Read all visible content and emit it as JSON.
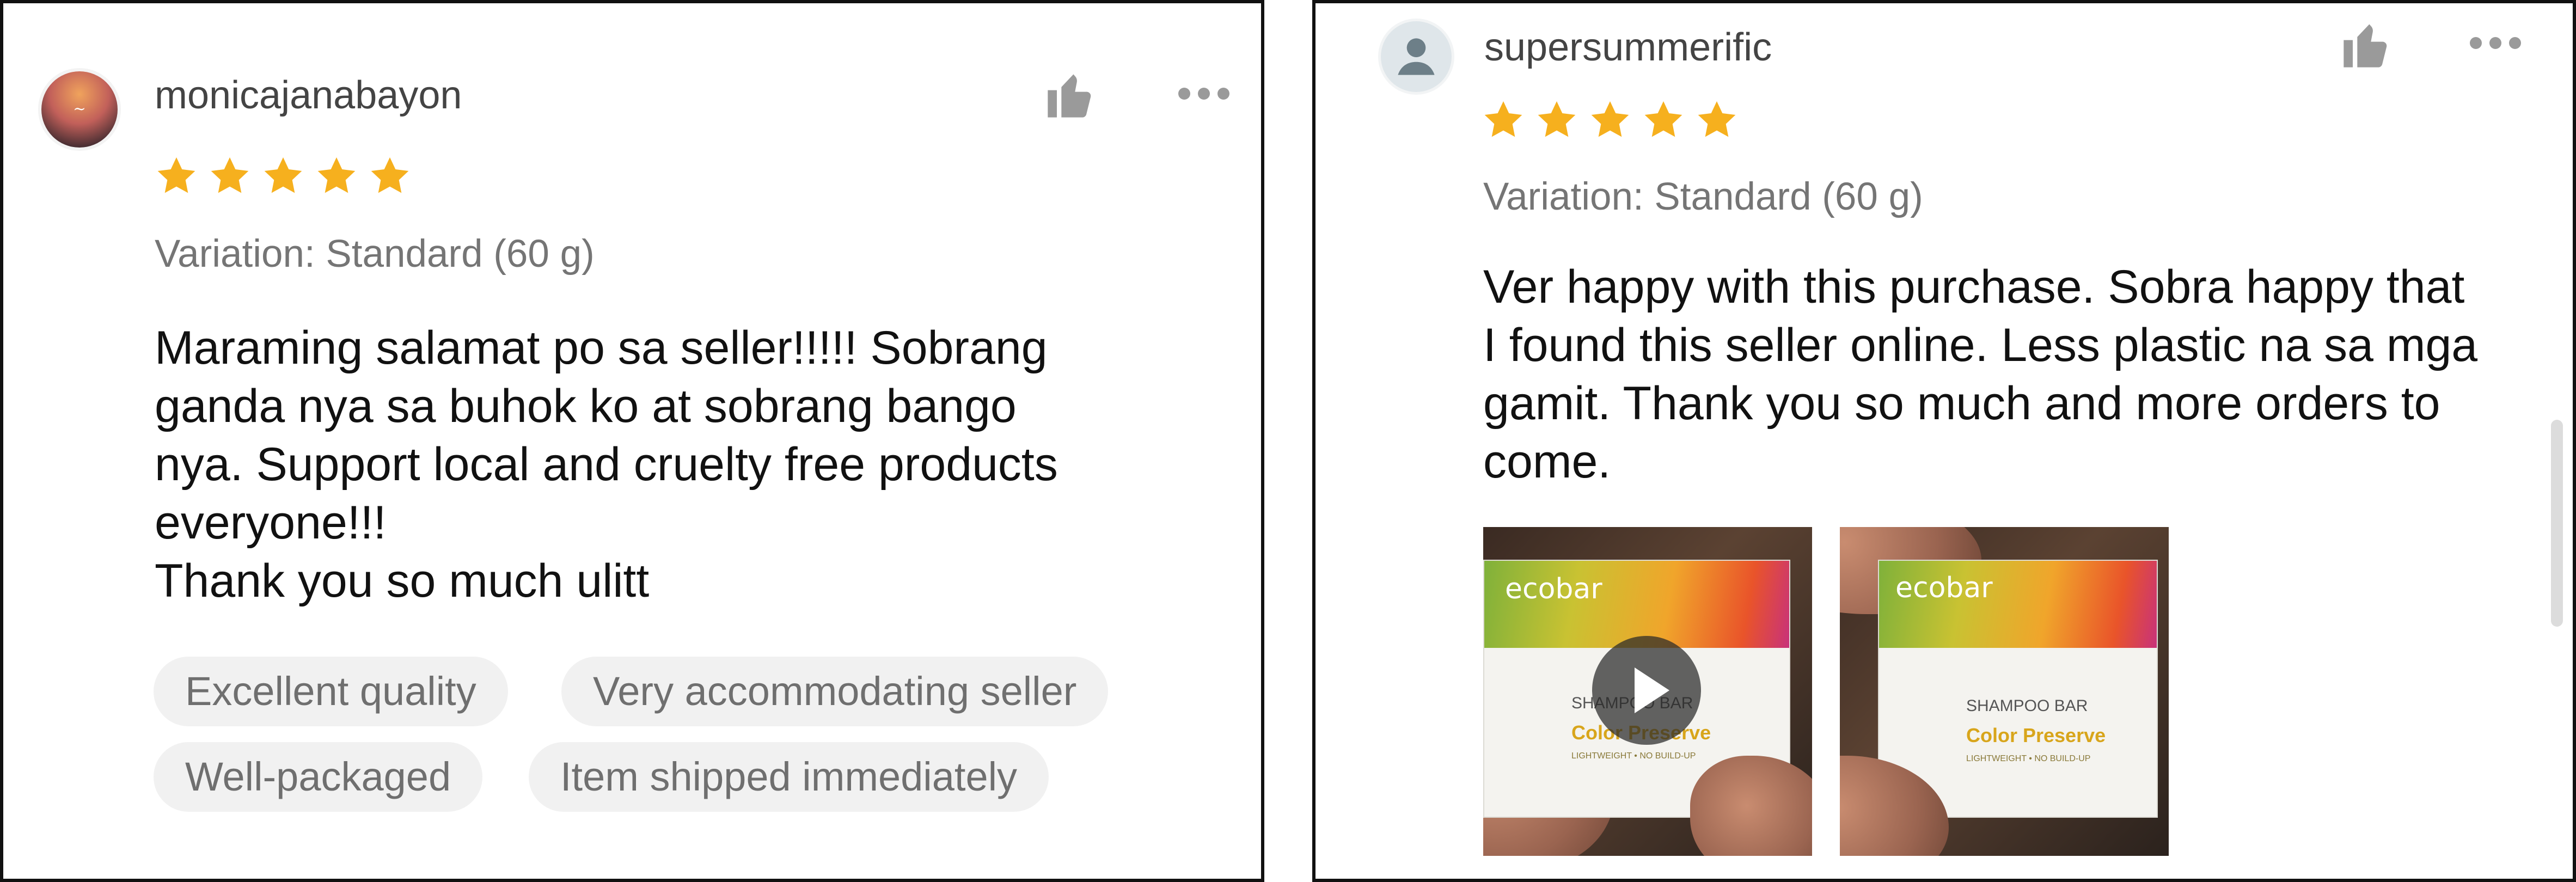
{
  "colors": {
    "star": "#f6b01e",
    "icon_gray": "#9a9a9a",
    "tag_bg": "#f1f1f1"
  },
  "reviews": [
    {
      "username": "monicajanabayon",
      "avatar": "profile-photo",
      "rating": 5,
      "variation": "Variation: Standard (60 g)",
      "comment_lines": [
        "Maraming salamat po sa seller!!!!! Sobrang",
        "ganda nya sa buhok ko at sobrang bango",
        "nya. Support local and cruelty free products",
        "everyone!!!",
        "Thank you so much ulitt"
      ],
      "tags": [
        "Excellent quality",
        "Very accommodating seller",
        "Well-packaged",
        "Item shipped immediately"
      ],
      "actions": [
        "thumbs-up-icon",
        "more-options-icon"
      ]
    },
    {
      "username": "supersummerific",
      "avatar": "default-person-avatar",
      "rating": 5,
      "variation": "Variation: Standard (60 g)",
      "comment_lines": [
        "Ver happy with this purchase. Sobra happy that",
        "I found this seller online. Less plastic na sa mga",
        "gamit. Thank you so much and more orders to",
        "come."
      ],
      "media": [
        {
          "kind": "video",
          "brand": "ecobar",
          "line1": "SHAMPOO BAR",
          "line2": "Color Preserve",
          "line3": "LIGHTWEIGHT • NO BUILD-UP"
        },
        {
          "kind": "photo",
          "brand": "ecobar",
          "line1": "SHAMPOO BAR",
          "line2": "Color Preserve",
          "line3": "LIGHTWEIGHT • NO BUILD-UP"
        }
      ],
      "actions": [
        "thumbs-up-icon",
        "more-options-icon"
      ]
    }
  ]
}
